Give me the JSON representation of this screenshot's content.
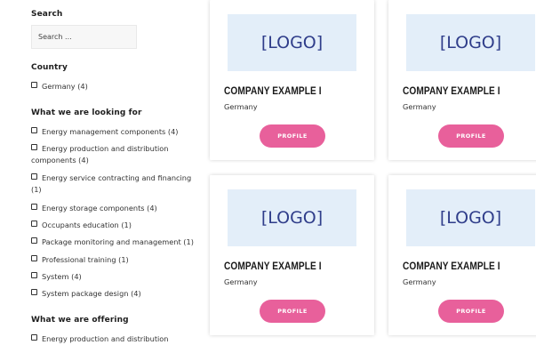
{
  "search": {
    "title": "Search",
    "placeholder": "Search ..."
  },
  "country": {
    "title": "Country",
    "items": [
      "Germany (4)"
    ]
  },
  "looking_for": {
    "title": "What we are looking for",
    "items": [
      "Energy management components (4)",
      "Energy production and distribution components (4)",
      "Energy service contracting and financing (1)",
      "Energy storage components (4)",
      "Occupants education (1)",
      "Package monitoring and management (1)",
      "Professional training (1)",
      "System (4)",
      "System package design (4)"
    ]
  },
  "offering": {
    "title": "What we are offering",
    "items": [
      "Energy production and distribution"
    ]
  },
  "cards": [
    {
      "logo": "[LOGO]",
      "company": "COMPANY EXAMPLE I",
      "country": "Germany",
      "button": "PROFILE"
    },
    {
      "logo": "[LOGO]",
      "company": "COMPANY EXAMPLE I",
      "country": "Germany",
      "button": "PROFILE"
    },
    {
      "logo": "[LOGO]",
      "company": "COMPANY EXAMPLE I",
      "country": "Germany",
      "button": "PROFILE"
    },
    {
      "logo": "[LOGO]",
      "company": "COMPANY EXAMPLE I",
      "country": "Germany",
      "button": "PROFILE"
    }
  ],
  "colors": {
    "accent": "#e8609b",
    "logo_bg": "#e3eef9",
    "logo_text": "#2f3d8a"
  }
}
